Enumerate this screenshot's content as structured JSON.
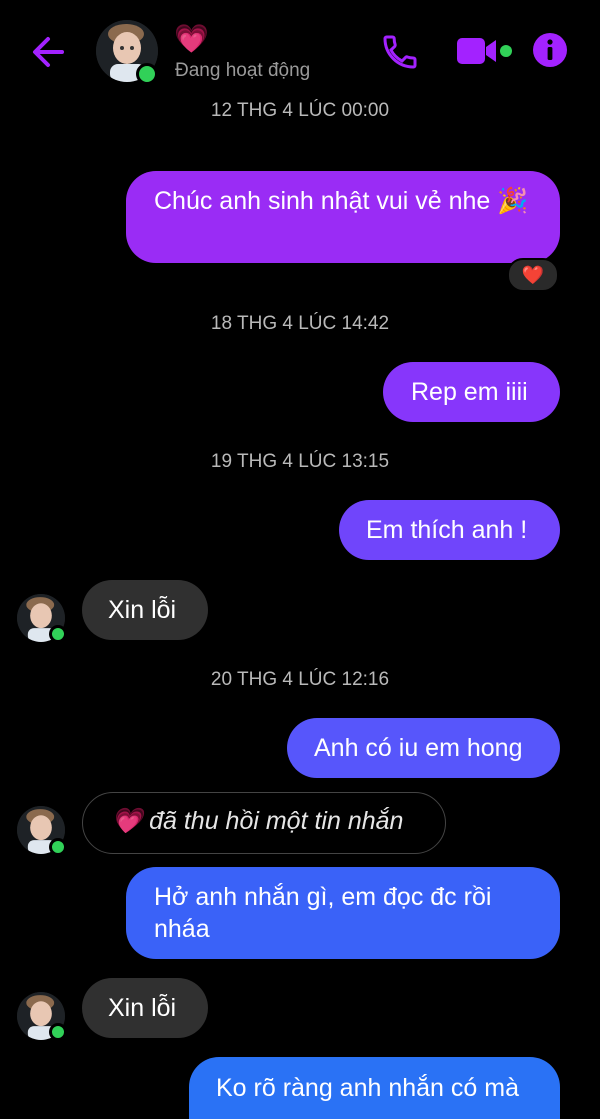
{
  "header": {
    "contact_name": "💗",
    "status": "Đang hoạt động",
    "colors": {
      "accent": "#a322ff",
      "online": "#31d158"
    },
    "icons": [
      "back-arrow-icon",
      "phone-icon",
      "video-camera-icon",
      "info-icon"
    ]
  },
  "messages": {
    "ts1": "12 THG 4 LÚC 00:00",
    "m1": "Chúc anh sinh nhật vui vẻ nhe 🎉",
    "m1_reaction": "❤️",
    "ts2": "18 THG 4 LÚC 14:42",
    "m2": "Rep em iiii",
    "ts3": "19 THG 4 LÚC 13:15",
    "m3": "Em thích anh !",
    "m4": "Xin lỗi",
    "ts4": "20 THG 4 LÚC 12:16",
    "m5": "Anh có iu em hong",
    "m6_icon": "💗",
    "m6": "đã thu hồi một tin nhắn",
    "m7": "Hở anh nhắn gì, em đọc đc rồi nháa",
    "m8": "Xin lỗi",
    "m9": "Ko rõ ràng anh nhắn có mà"
  },
  "bubble_colors": [
    "#9a2cf5",
    "#8736fb",
    "#7045fb",
    "#5756fb",
    "#3a62f8",
    "#2d6bf6",
    "#2a72f5"
  ]
}
